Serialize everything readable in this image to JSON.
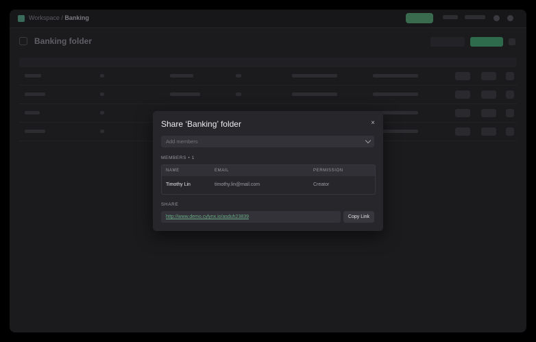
{
  "app": {
    "breadcrumb_root": "Workspace",
    "breadcrumb_current": "Banking",
    "page_title": "Banking folder"
  },
  "modal": {
    "title": "Share ‘Banking’ folder",
    "close_icon": "×",
    "add_members_placeholder": "Add members",
    "members_label": "MEMBERS • 1",
    "columns": {
      "name": "NAME",
      "email": "EMAIL",
      "permission": "PERMISSION"
    },
    "members": [
      {
        "name": "Timothy Lin",
        "email": "timothy.lin@mail.com",
        "permission": "Creator"
      }
    ],
    "share_label": "SHARE",
    "share_link": "http://www.demo.cylynx.io/asduh23839",
    "copy_button": "Copy Link"
  },
  "icons": [
    "close-icon",
    "chevron-down-icon"
  ],
  "colors": {
    "link": "#6cab8a",
    "accent": "#2e6b4c"
  }
}
